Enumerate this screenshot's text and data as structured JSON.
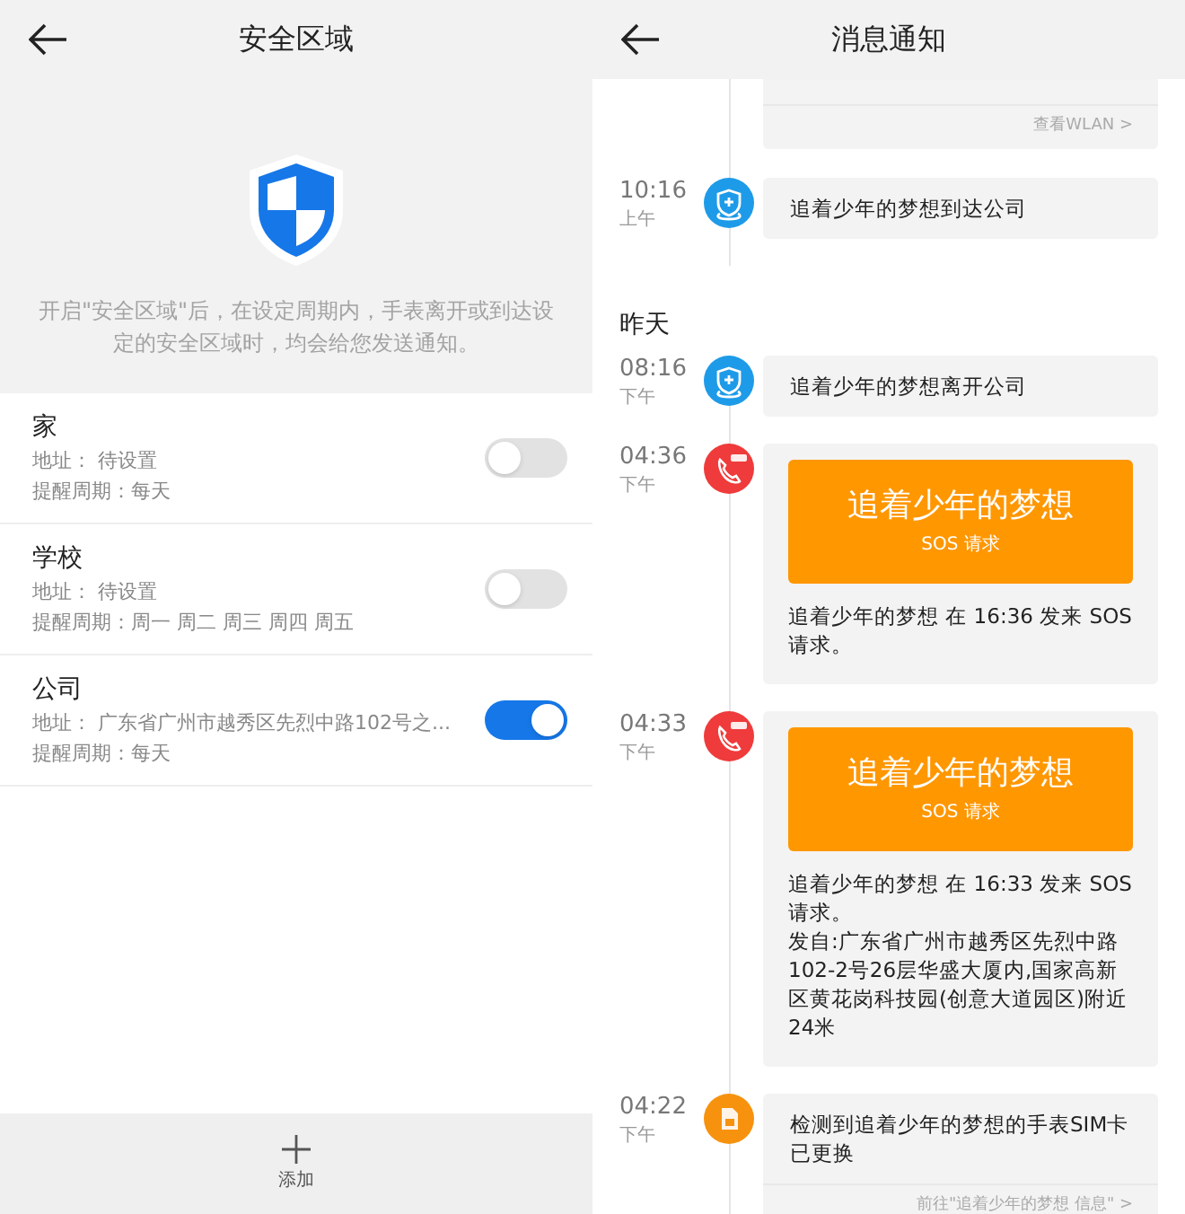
{
  "safe_zone": {
    "title": "安全区域",
    "description": "开启\"安全区域\"后，在设定周期内，手表离开或到达设定的安全区域时，均会给您发送通知。",
    "zones": [
      {
        "name": "家",
        "address": "地址： 待设置",
        "reminder": "提醒周期：每天",
        "on": false
      },
      {
        "name": "学校",
        "address": "地址： 待设置",
        "reminder": "提醒周期：周一 周二 周三 周四 周五",
        "on": false
      },
      {
        "name": "公司",
        "address": "地址： 广东省广州市越秀区先烈中路102号之...",
        "reminder": "提醒周期：每天",
        "on": true
      }
    ],
    "add_label": "添加"
  },
  "notifications": {
    "title": "消息通知",
    "items": [
      {
        "kind": "partial",
        "link": "查看WLAN >"
      },
      {
        "kind": "event",
        "time": "10:16",
        "period": "上午",
        "badge": {
          "kind": "location",
          "color": "#1e9be8"
        },
        "paragraphs": [
          "追着少年的梦想到达公司"
        ]
      },
      {
        "kind": "day",
        "label": "昨天"
      },
      {
        "kind": "event",
        "time": "08:16",
        "period": "下午",
        "badge": {
          "kind": "location",
          "color": "#1e9be8"
        },
        "paragraphs": [
          "追着少年的梦想离开公司"
        ]
      },
      {
        "kind": "sos",
        "time": "04:36",
        "period": "下午",
        "badge": {
          "kind": "sos",
          "color": "#ef3b3b"
        },
        "banner_title": "追着少年的梦想",
        "banner_subtitle": "SOS 请求",
        "paragraphs": [
          "追着少年的梦想 在 16:36 发来 SOS 请求。"
        ]
      },
      {
        "kind": "sos",
        "time": "04:33",
        "period": "下午",
        "badge": {
          "kind": "sos",
          "color": "#ef3b3b"
        },
        "banner_title": "追着少年的梦想",
        "banner_subtitle": "SOS 请求",
        "paragraphs": [
          "追着少年的梦想 在 16:33 发来 SOS 请求。",
          "发自:广东省广州市越秀区先烈中路102-2号26层华盛大厦内,国家高新区黄花岗科技园(创意大道园区)附近24米"
        ]
      },
      {
        "kind": "event",
        "time": "04:22",
        "period": "下午",
        "badge": {
          "kind": "sim",
          "color": "#f7920f"
        },
        "paragraphs": [
          "检测到追着少年的梦想的手表SIM卡已更换"
        ],
        "link": "前往\"追着少年的梦想 信息\" >"
      }
    ]
  }
}
